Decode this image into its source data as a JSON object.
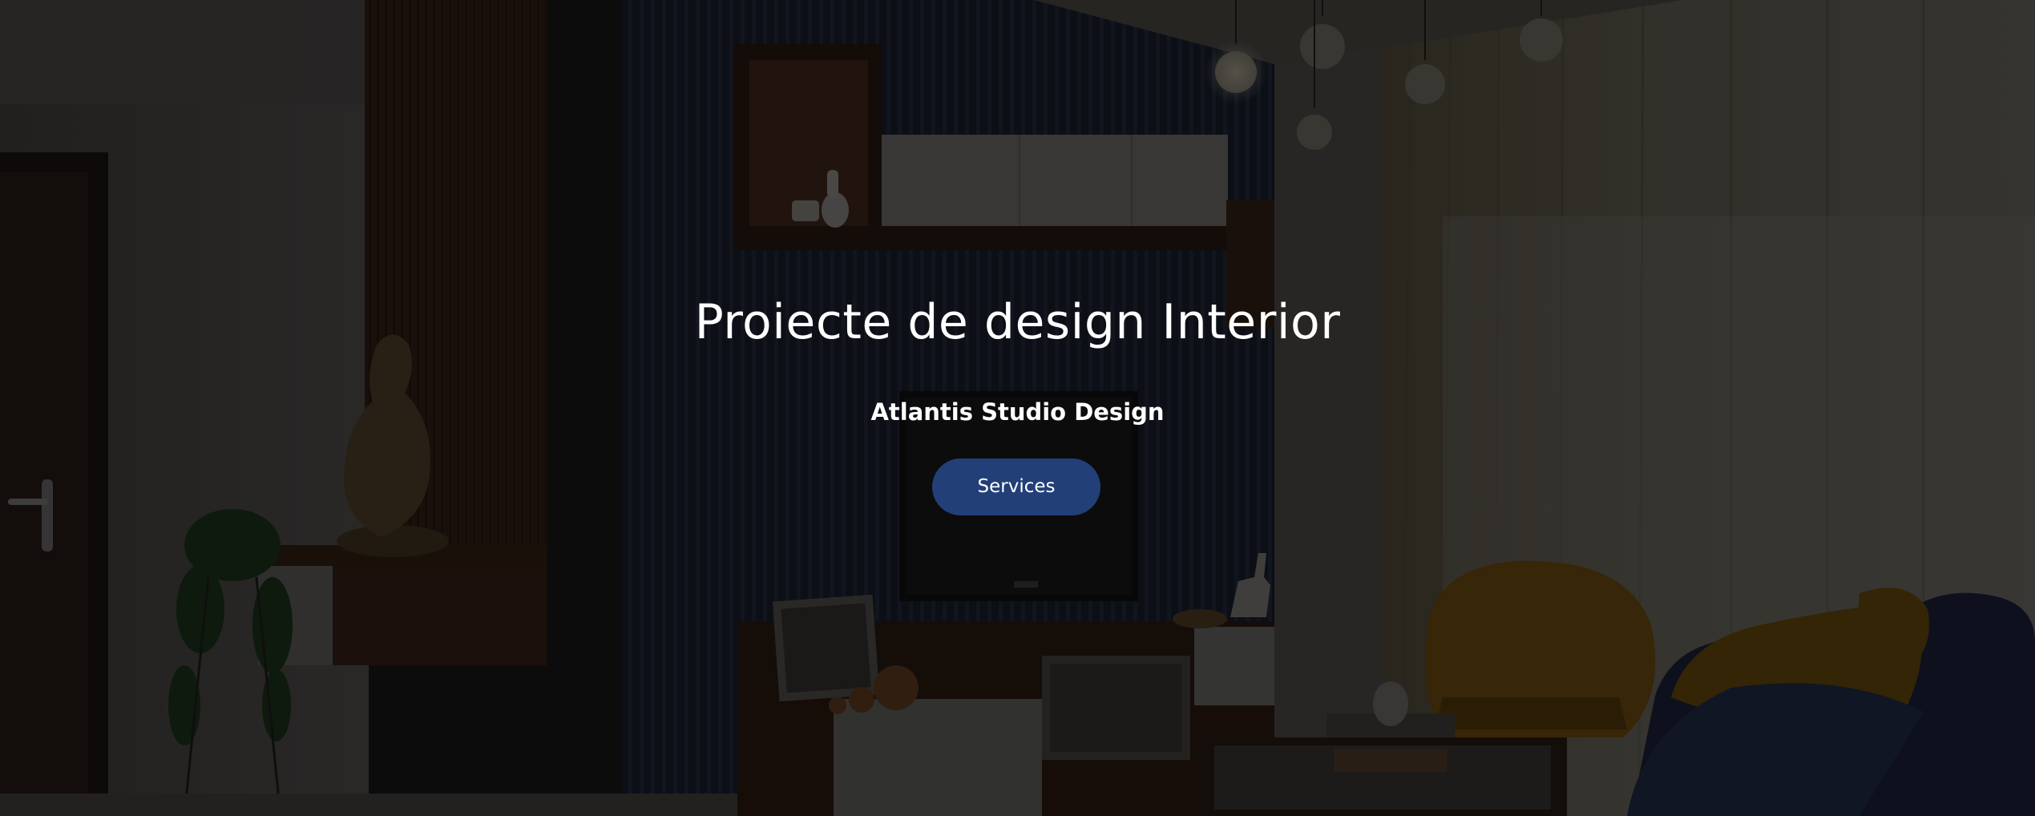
{
  "hero": {
    "title": "Proiecte de design Interior",
    "subtitle": "Atlantis Studio Design",
    "cta_label": "Services",
    "background": "living-room-interior-photo"
  },
  "colors": {
    "button_bg": "#223f78",
    "text": "#ffffff",
    "overlay": "rgba(0,0,0,0.55)"
  }
}
